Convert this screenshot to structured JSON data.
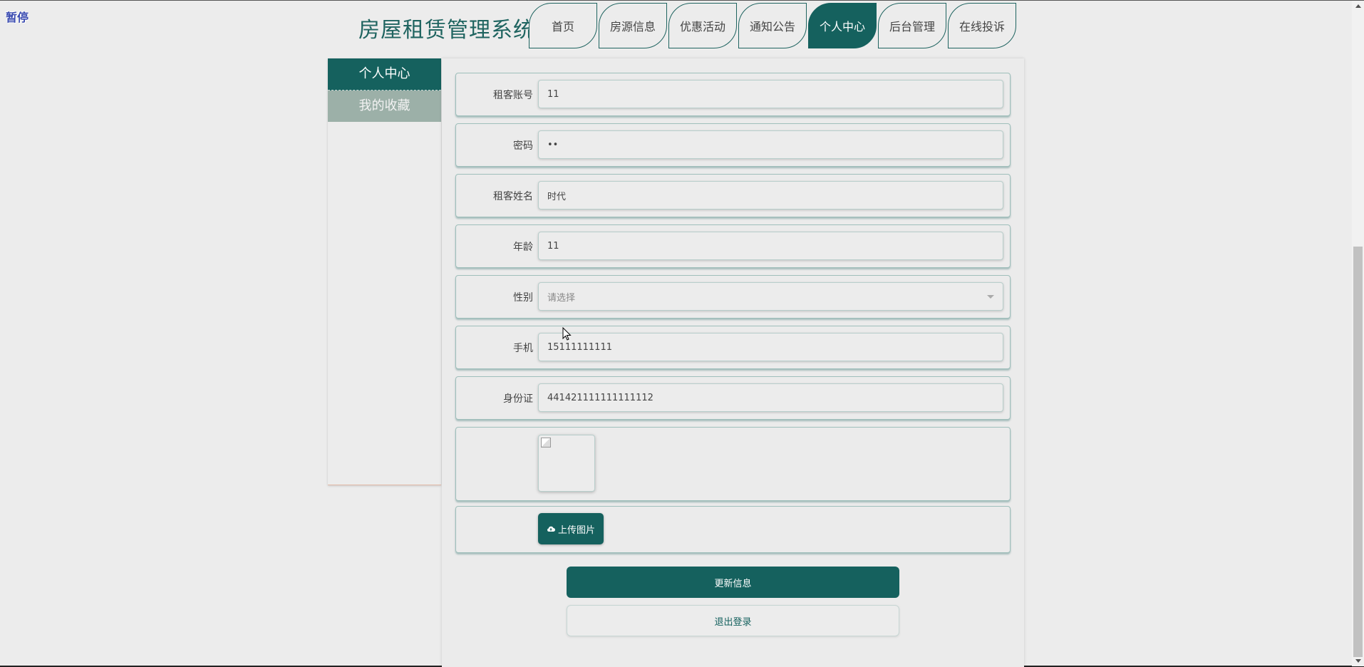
{
  "overlay": {
    "pause_label": "暂停"
  },
  "header": {
    "site_title": "房屋租赁管理系统",
    "nav": [
      {
        "label": "首页",
        "active": false
      },
      {
        "label": "房源信息",
        "active": false
      },
      {
        "label": "优惠活动",
        "active": false
      },
      {
        "label": "通知公告",
        "active": false
      },
      {
        "label": "个人中心",
        "active": true
      },
      {
        "label": "后台管理",
        "active": false
      },
      {
        "label": "在线投诉",
        "active": false
      }
    ]
  },
  "sidebar": {
    "items": [
      {
        "label": "个人中心",
        "active": true
      },
      {
        "label": "我的收藏",
        "active": false
      }
    ]
  },
  "form": {
    "fields": [
      {
        "label": "租客账号",
        "value": "11"
      },
      {
        "label": "密码",
        "value": "••"
      },
      {
        "label": "租客姓名",
        "value": "时代"
      },
      {
        "label": "年龄",
        "value": "11"
      },
      {
        "label": "性别",
        "value": "",
        "placeholder": "请选择"
      },
      {
        "label": "手机",
        "value": "15111111111"
      },
      {
        "label": "身份证",
        "value": "441421111111111112"
      }
    ],
    "upload_label": "上传图片",
    "update_label": "更新信息",
    "logout_label": "退出登录"
  },
  "colors": {
    "accent": "#15615e",
    "title": "#1f6460",
    "sidebar_inactive": "#9cb0a8",
    "background": "#ececec"
  }
}
